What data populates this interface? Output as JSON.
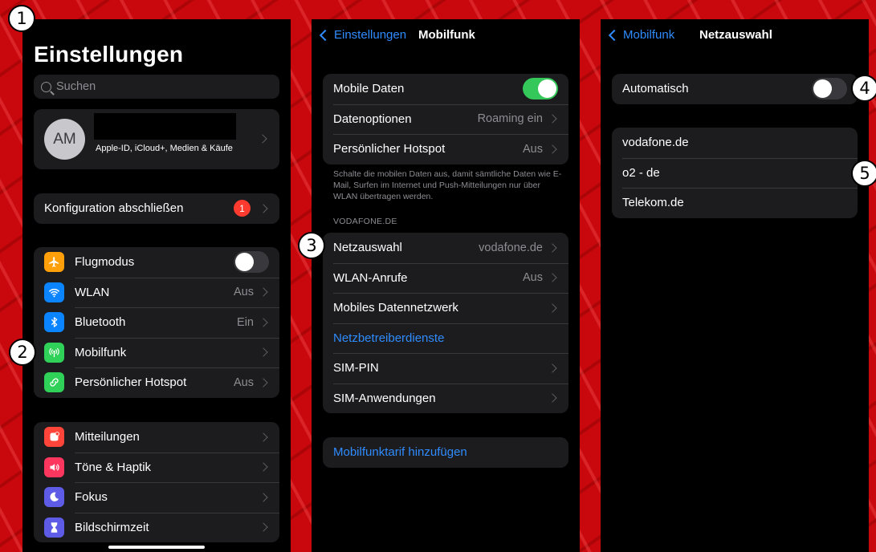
{
  "colors": {
    "accent": "#2f8cff",
    "toggle_on": "#34c759",
    "badge": "#ff3b30",
    "background": "#c8080d"
  },
  "markers": [
    "1",
    "2",
    "3",
    "4",
    "5"
  ],
  "screen1": {
    "title": "Einstellungen",
    "search_placeholder": "Suchen",
    "profile": {
      "initials": "AM",
      "subtitle": "Apple-ID, iCloud+, Medien & Käufe"
    },
    "config": {
      "label": "Konfiguration abschließen",
      "badge": "1"
    },
    "connectivity": [
      {
        "label": "Flugmodus",
        "icon": "airplane-icon",
        "color": "#ff9f0a",
        "toggle": false
      },
      {
        "label": "WLAN",
        "value": "Aus",
        "icon": "wifi-icon",
        "color": "#0a84ff"
      },
      {
        "label": "Bluetooth",
        "value": "Ein",
        "icon": "bluetooth-icon",
        "color": "#0a84ff"
      },
      {
        "label": "Mobilfunk",
        "icon": "antenna-icon",
        "color": "#30d158"
      },
      {
        "label": "Persönlicher Hotspot",
        "value": "Aus",
        "icon": "hotspot-icon",
        "color": "#30d158"
      }
    ],
    "notifications": [
      {
        "label": "Mitteilungen",
        "icon": "notifications-icon",
        "color": "#ff453a"
      },
      {
        "label": "Töne & Haptik",
        "icon": "speaker-icon",
        "color": "#ff375f"
      },
      {
        "label": "Fokus",
        "icon": "moon-icon",
        "color": "#5e5ce6"
      },
      {
        "label": "Bildschirmzeit",
        "icon": "hourglass-icon",
        "color": "#5e5ce6"
      }
    ]
  },
  "screen2": {
    "back_label": "Einstellungen",
    "title": "Mobilfunk",
    "group1": [
      {
        "label": "Mobile Daten",
        "toggle": true
      },
      {
        "label": "Datenoptionen",
        "value": "Roaming ein"
      },
      {
        "label": "Persönlicher Hotspot",
        "value": "Aus"
      }
    ],
    "footnote": "Schalte die mobilen Daten aus, damit sämtliche Daten wie E-Mail, Surfen im Internet und Push-Mitteilungen nur über WLAN übertragen werden.",
    "section_header": "VODAFONE.DE",
    "group2": [
      {
        "label": "Netzauswahl",
        "value": "vodafone.de"
      },
      {
        "label": "WLAN-Anrufe",
        "value": "Aus"
      },
      {
        "label": "Mobiles Datennetzwerk"
      },
      {
        "label": "Netzbetreiberdienste",
        "link": true
      },
      {
        "label": "SIM-PIN"
      },
      {
        "label": "SIM-Anwendungen"
      }
    ],
    "add_plan": "Mobilfunktarif hinzufügen"
  },
  "screen3": {
    "back_label": "Mobilfunk",
    "title": "Netzauswahl",
    "automatic_label": "Automatisch",
    "automatic_on": false,
    "networks": [
      "vodafone.de",
      "o2 - de",
      "Telekom.de"
    ]
  }
}
